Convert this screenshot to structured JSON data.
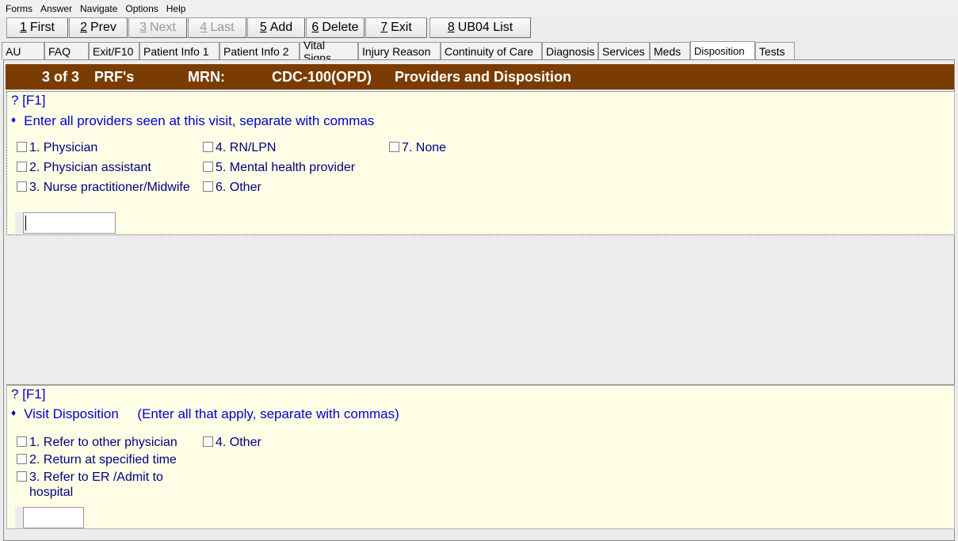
{
  "menu": [
    "Forms",
    "Answer",
    "Navigate",
    "Options",
    "Help"
  ],
  "toolbar": [
    {
      "key": "1",
      "label": "First",
      "enabled": true
    },
    {
      "key": "2",
      "label": "Prev",
      "enabled": true
    },
    {
      "key": "3",
      "label": "Next",
      "enabled": false
    },
    {
      "key": "4",
      "label": "Last",
      "enabled": false
    },
    {
      "key": "5",
      "label": "Add",
      "enabled": true
    },
    {
      "key": "6",
      "label": "Delete",
      "enabled": true
    },
    {
      "key": "7",
      "label": "Exit",
      "enabled": true
    },
    {
      "key": "8",
      "label": "UB04 List",
      "enabled": true
    }
  ],
  "tabs": [
    "AU",
    "FAQ",
    "Exit/F10",
    "Patient Info 1",
    "Patient Info 2",
    "Vital Signs",
    "Injury Reason",
    "Continuity of Care",
    "Diagnosis",
    "Services",
    "Meds",
    "Disposition",
    "Tests"
  ],
  "active_tab": "Disposition",
  "header": {
    "record": "3 of 3",
    "form": "PRF's",
    "mrn_label": "MRN:",
    "mrn_value": "CDC-100(OPD)",
    "title": "Providers and Disposition"
  },
  "providers": {
    "help": "? [F1]",
    "bullet": "♦",
    "question": "Enter all providers seen at this visit, separate with commas",
    "options": [
      "1. Physician",
      "2. Physician assistant",
      "3. Nurse practitioner/Midwife",
      "4. RN/LPN",
      "5. Mental health provider",
      "6. Other",
      "7. None"
    ],
    "input_value": ""
  },
  "disposition": {
    "help": "? [F1]",
    "bullet": "♦",
    "question": "Visit Disposition     (Enter all that apply, separate with commas)",
    "options": [
      "1. Refer to other physician",
      "2. Return at specified time",
      "3. Refer to ER /Admit to hospital",
      "4. Other"
    ],
    "input_value": ""
  },
  "colors": {
    "header_bg": "#7a3c00",
    "section_bg": "#fefee6",
    "question_text": "#0000cc",
    "option_text": "#000080"
  }
}
